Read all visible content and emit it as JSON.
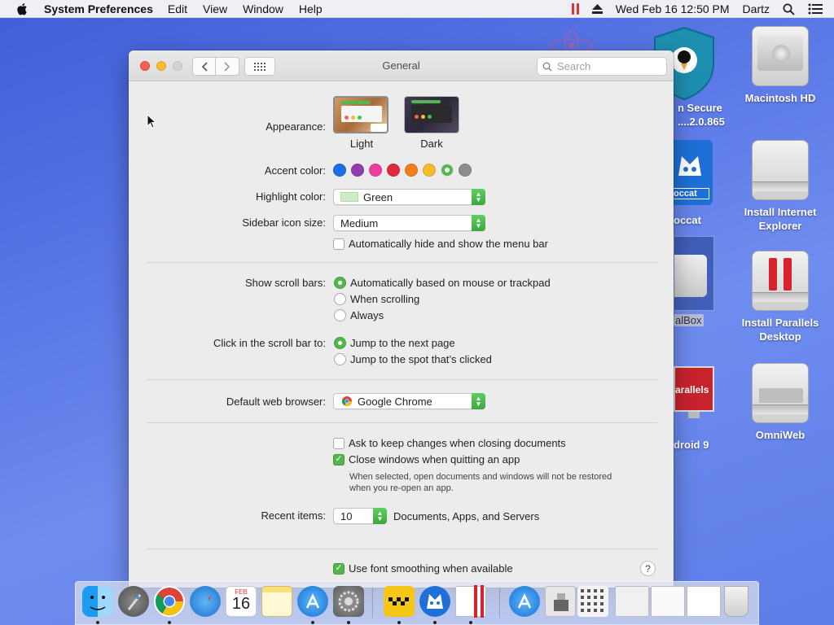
{
  "menubar": {
    "app_name": "System Preferences",
    "items": [
      "Edit",
      "View",
      "Window",
      "Help"
    ],
    "clock": "Wed Feb 16  12:50 PM",
    "user": "Dartz"
  },
  "desktop": {
    "icons": [
      {
        "label": "Macintosh HD"
      },
      {
        "label": "Install Internet Explorer"
      },
      {
        "label": "Install Parallels Desktop"
      },
      {
        "label": "OmniWeb"
      }
    ],
    "partial_labels": [
      "n Secure",
      "....2.0.865",
      "occat",
      "occat",
      "alBox",
      "arallels",
      "droid 9"
    ]
  },
  "window": {
    "title": "General",
    "search_placeholder": "Search",
    "appearance": {
      "label": "Appearance:",
      "options": [
        {
          "name": "Light",
          "selected": true
        },
        {
          "name": "Dark",
          "selected": false
        }
      ]
    },
    "accent": {
      "label": "Accent color:",
      "colors": [
        "#1a70e6",
        "#913dad",
        "#ec3f99",
        "#de2b3d",
        "#f47d1c",
        "#f5bb2a",
        "#55b54e",
        "#8c8c8c"
      ],
      "selected_index": 6
    },
    "highlight": {
      "label": "Highlight color:",
      "value": "Green",
      "swatch": "#cdeec5"
    },
    "sidebar_size": {
      "label": "Sidebar icon size:",
      "value": "Medium"
    },
    "menu_bar_autohide": {
      "label": "Automatically hide and show the menu bar",
      "checked": false
    },
    "scroll_bars": {
      "label": "Show scroll bars:",
      "options": [
        {
          "label": "Automatically based on mouse or trackpad",
          "on": true
        },
        {
          "label": "When scrolling",
          "on": false
        },
        {
          "label": "Always",
          "on": false
        }
      ]
    },
    "scroll_click": {
      "label": "Click in the scroll bar to:",
      "options": [
        {
          "label": "Jump to the next page",
          "on": true
        },
        {
          "label": "Jump to the spot that’s clicked",
          "on": false
        }
      ]
    },
    "browser": {
      "label": "Default web browser:",
      "value": "Google Chrome"
    },
    "ask_keep": {
      "label": "Ask to keep changes when closing documents",
      "checked": false
    },
    "close_windows": {
      "label": "Close windows when quitting an app",
      "checked": true
    },
    "close_note_1": "When selected, open documents and windows will not be restored",
    "close_note_2": "when you re-open an app.",
    "recent": {
      "label": "Recent items:",
      "value": "10",
      "suffix": "Documents, Apps, and Servers"
    },
    "font_smoothing": {
      "label": "Use font smoothing when available",
      "checked": true
    },
    "help_glyph": "?"
  },
  "dock": {
    "apps": [
      "Finder",
      "Launchpad",
      "Google Chrome",
      "Safari",
      "Calendar",
      "Notes",
      "App Store",
      "System Preferences",
      "Taxi",
      "Boccat",
      "Parallels",
      "App Store Folder",
      "Downloads",
      "Icons",
      "Screenshot",
      "Screenshot",
      "Screenshot",
      "Trash"
    ],
    "calendar_month": "FEB",
    "calendar_day": "16"
  },
  "colors": {
    "accent_green": "#55b54e",
    "desktop": "#5a78e6"
  }
}
